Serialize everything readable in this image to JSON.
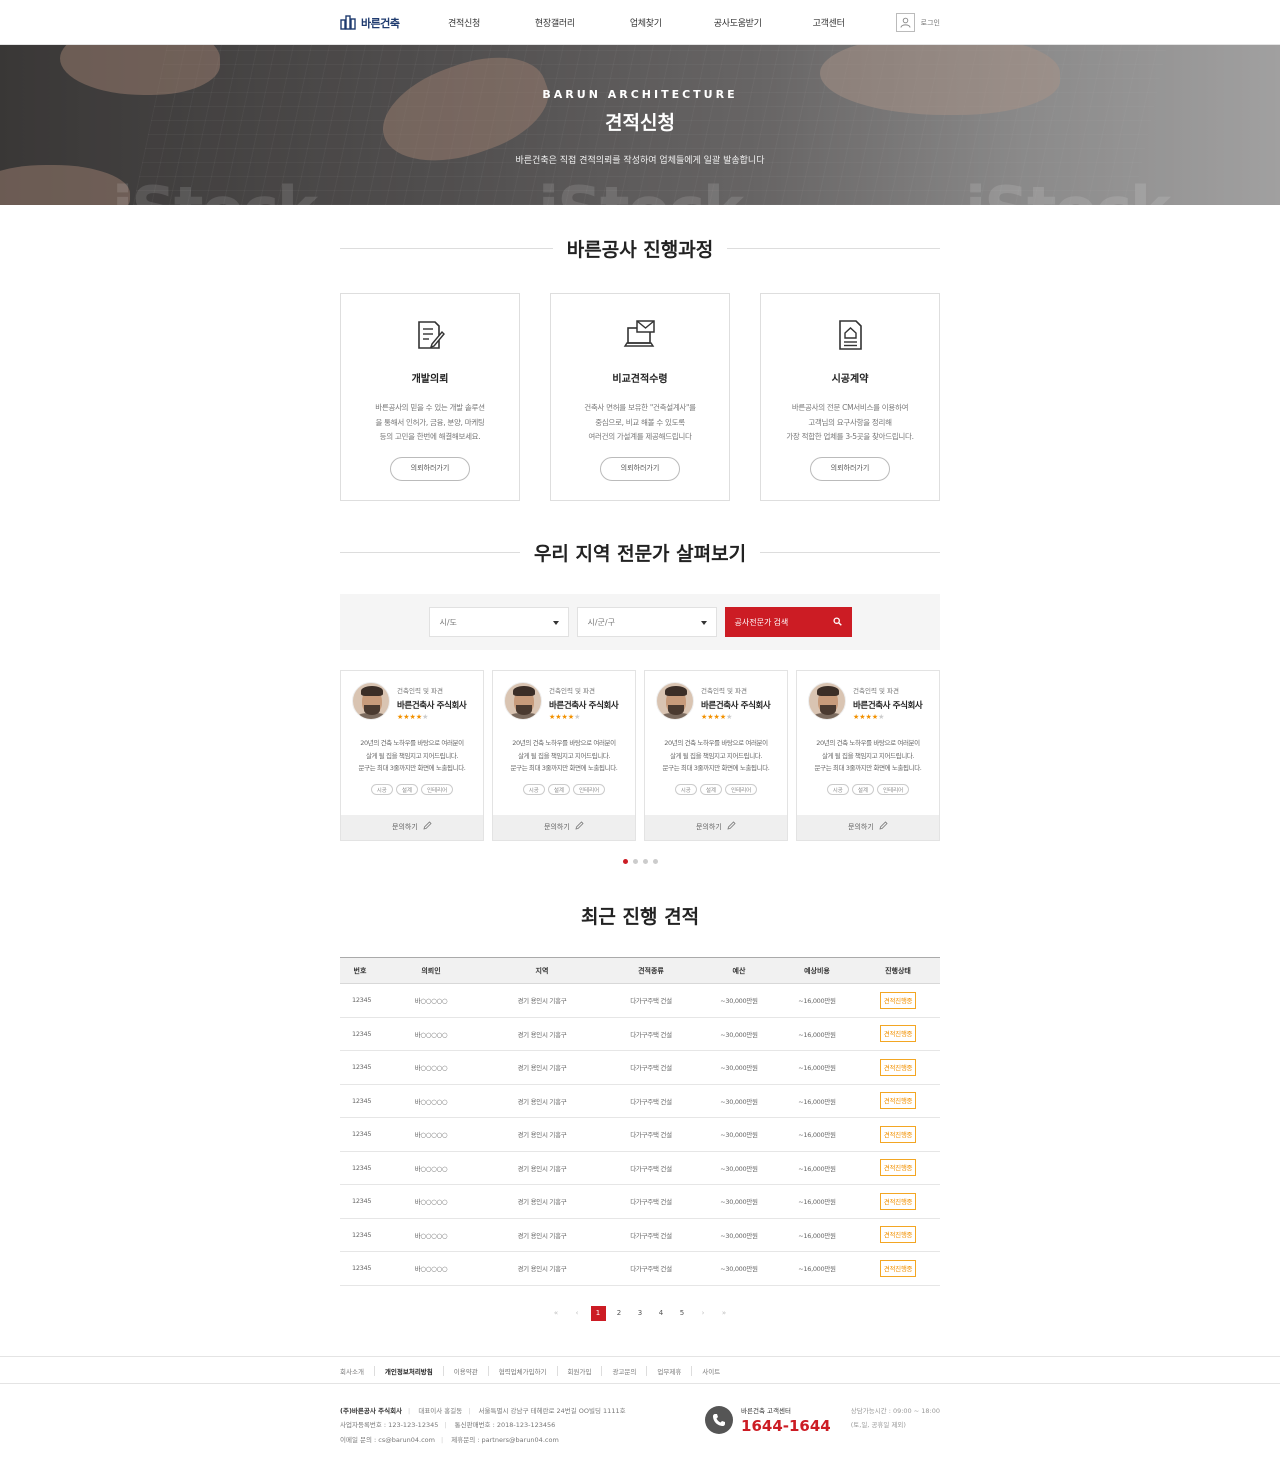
{
  "header": {
    "logo": "바른건축",
    "nav": [
      "견적신청",
      "현장갤러리",
      "업체찾기",
      "공사도움받기",
      "고객센터"
    ],
    "login": "로그인"
  },
  "hero": {
    "eyebrow": "BARUN ARCHITECTURE",
    "title": "견적신청",
    "subtitle": "바른건축은 직접 견적의뢰를 작성하여 업체들에게 일괄 발송합니다",
    "watermark": "iStock"
  },
  "process": {
    "title": "바른공사 진행과정",
    "cards": [
      {
        "icon": "document-edit-icon",
        "title": "개발의뢰",
        "lines": [
          "바른공사의 믿을 수 있는 개발 솔루션",
          "을 통해서 인허가, 금융, 분양, 마케팅",
          "등의 고민을 한번에 해결해보세요."
        ],
        "button": "의뢰하러가기"
      },
      {
        "icon": "laptop-mail-icon",
        "title": "비교견적수령",
        "lines": [
          "건축사 면허를 보유한 \"건축설계사\"를",
          "중심으로, 비교 해볼 수 있도록",
          "여러건의 가설계를 제공해드립니다"
        ],
        "button": "의뢰하러가기"
      },
      {
        "icon": "contract-house-icon",
        "title": "시공계약",
        "lines": [
          "바른공사의 전문 CM서비스를 이용하여",
          "고객님의 요구사항을 정리해",
          "가장 적합한 업체를 3-5곳을 찾아드립니다."
        ],
        "button": "의뢰하러가기"
      }
    ]
  },
  "experts": {
    "title": "우리 지역 전문가 살펴보기",
    "select_city": "시/도",
    "select_district": "시/군/구",
    "search_button": "공사전문가 검색",
    "cards": [
      {
        "category": "건축인력 및 파견",
        "name": "바른건축사 주식회사",
        "rating": 4,
        "lines": [
          "20년의 건축 노하우를 바탕으로 여러분이",
          "살게 될 집을 책임지고 지어드립니다.",
          "문구는 최대 3줄까지만 화면에 노출됩니다."
        ],
        "tags": [
          "시공",
          "설계",
          "인테리어"
        ],
        "inquiry": "문의하기"
      },
      {
        "category": "건축인력 및 파견",
        "name": "바른건축사 주식회사",
        "rating": 4,
        "lines": [
          "20년의 건축 노하우를 바탕으로 여러분이",
          "살게 될 집을 책임지고 지어드립니다.",
          "문구는 최대 3줄까지만 화면에 노출됩니다."
        ],
        "tags": [
          "시공",
          "설계",
          "인테리어"
        ],
        "inquiry": "문의하기"
      },
      {
        "category": "건축인력 및 파견",
        "name": "바른건축사 주식회사",
        "rating": 4,
        "lines": [
          "20년의 건축 노하우를 바탕으로 여러분이",
          "살게 될 집을 책임지고 지어드립니다.",
          "문구는 최대 3줄까지만 화면에 노출됩니다."
        ],
        "tags": [
          "시공",
          "설계",
          "인테리어"
        ],
        "inquiry": "문의하기"
      },
      {
        "category": "건축인력 및 파견",
        "name": "바른건축사 주식회사",
        "rating": 4,
        "lines": [
          "20년의 건축 노하우를 바탕으로 여러분이",
          "살게 될 집을 책임지고 지어드립니다.",
          "문구는 최대 3줄까지만 화면에 노출됩니다."
        ],
        "tags": [
          "시공",
          "설계",
          "인테리어"
        ],
        "inquiry": "문의하기"
      }
    ],
    "active_slide": 1,
    "slide_count": 4
  },
  "recent": {
    "title": "최근 진행 견적",
    "columns": [
      "번호",
      "의뢰인",
      "지역",
      "견적종류",
      "예산",
      "예상비용",
      "진행상태"
    ],
    "rows": [
      [
        "12345",
        "바○○○○○",
        "경기 용인시 기흥구",
        "다가구주택 건설",
        "~30,000만원",
        "~16,000만원",
        "견적진행중"
      ],
      [
        "12345",
        "바○○○○○",
        "경기 용인시 기흥구",
        "다가구주택 건설",
        "~30,000만원",
        "~16,000만원",
        "견적진행중"
      ],
      [
        "12345",
        "바○○○○○",
        "경기 용인시 기흥구",
        "다가구주택 건설",
        "~30,000만원",
        "~16,000만원",
        "견적진행중"
      ],
      [
        "12345",
        "바○○○○○",
        "경기 용인시 기흥구",
        "다가구주택 건설",
        "~30,000만원",
        "~16,000만원",
        "견적진행중"
      ],
      [
        "12345",
        "바○○○○○",
        "경기 용인시 기흥구",
        "다가구주택 건설",
        "~30,000만원",
        "~16,000만원",
        "견적진행중"
      ],
      [
        "12345",
        "바○○○○○",
        "경기 용인시 기흥구",
        "다가구주택 건설",
        "~30,000만원",
        "~16,000만원",
        "견적진행중"
      ],
      [
        "12345",
        "바○○○○○",
        "경기 용인시 기흥구",
        "다가구주택 건설",
        "~30,000만원",
        "~16,000만원",
        "견적진행중"
      ],
      [
        "12345",
        "바○○○○○",
        "경기 용인시 기흥구",
        "다가구주택 건설",
        "~30,000만원",
        "~16,000만원",
        "견적진행중"
      ],
      [
        "12345",
        "바○○○○○",
        "경기 용인시 기흥구",
        "다가구주택 건설",
        "~30,000만원",
        "~16,000만원",
        "견적진행중"
      ]
    ],
    "pages": [
      "1",
      "2",
      "3",
      "4",
      "5"
    ],
    "current_page": "1"
  },
  "footer": {
    "links": [
      "회사소개",
      "개인정보처리방침",
      "이용약관",
      "협력업체가입하기",
      "회원가입",
      "광고문의",
      "업무제휴",
      "사이트"
    ],
    "company": "(주)바른공사 주식회사",
    "ceo": "대표이사 홍길동",
    "address": "서울특별시 강남구 테헤란로 24번길 OO빌딩 1111호",
    "biz_no": "사업자등록번호 : 123-123-12345",
    "telecom_no": "통신판매번호 : 2018-123-123456",
    "email": "이메일 문의 : cs@barun04.com",
    "partner_email": "제휴문의 : partners@barun04.com",
    "cc_name": "바른건축 고객센터",
    "cc_number": "1644-1644",
    "cc_hours": "상담가능시간 : 09:00 ~ 18:00",
    "cc_closed": "(토,일, 공휴일 제외)"
  },
  "colors": {
    "accent": "#cc1c24",
    "status": "#f29100",
    "logo": "#1f3b6f"
  }
}
